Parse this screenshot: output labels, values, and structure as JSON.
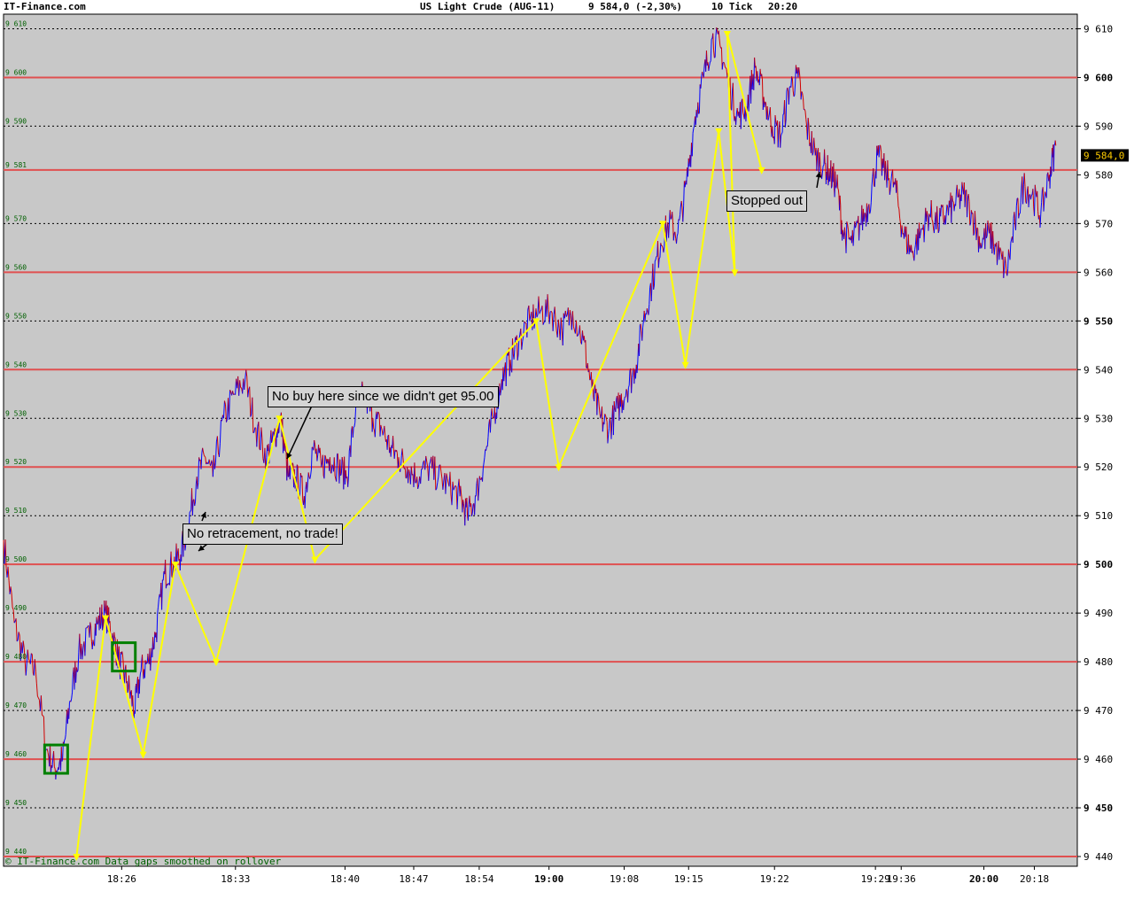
{
  "header": {
    "site": "IT-Finance.com",
    "instrument": "US Light Crude (AUG-11)",
    "quote": "9 584,0 (-2,30%)",
    "interval": "10 Tick",
    "time": "20:20"
  },
  "footer": "© IT-Finance.com Data gaps smoothed on rollover",
  "colors": {
    "plot_bg": "#c8c8c8",
    "red_level": "#e05050",
    "price_up": "#0000ff",
    "price_down": "#d00000",
    "swing_line": "#ffff00",
    "entry_box": "#008000",
    "last_price_badge": "#ffcc00"
  },
  "annotations": {
    "no_buy": "No buy here since we didn't get 95.00",
    "no_retracement": "No retracement, no trade!",
    "stopped_out": "Stopped out"
  },
  "chart_data": {
    "type": "line",
    "title": "US Light Crude (AUG-11)",
    "ylim": [
      9438,
      9613
    ],
    "y_ticks_right": [
      {
        "value": 9610,
        "label": "9 610",
        "bold": false
      },
      {
        "value": 9600,
        "label": "9 600",
        "bold": true
      },
      {
        "value": 9590,
        "label": "9 590",
        "bold": false
      },
      {
        "value": 9580,
        "label": "9 580",
        "bold": false
      },
      {
        "value": 9570,
        "label": "9 570",
        "bold": false
      },
      {
        "value": 9560,
        "label": "9 560",
        "bold": false
      },
      {
        "value": 9550,
        "label": "9 550",
        "bold": true
      },
      {
        "value": 9540,
        "label": "9 540",
        "bold": false
      },
      {
        "value": 9530,
        "label": "9 530",
        "bold": false
      },
      {
        "value": 9520,
        "label": "9 520",
        "bold": false
      },
      {
        "value": 9510,
        "label": "9 510",
        "bold": false
      },
      {
        "value": 9500,
        "label": "9 500",
        "bold": true
      },
      {
        "value": 9490,
        "label": "9 490",
        "bold": false
      },
      {
        "value": 9480,
        "label": "9 480",
        "bold": false
      },
      {
        "value": 9470,
        "label": "9 470",
        "bold": false
      },
      {
        "value": 9460,
        "label": "9 460",
        "bold": false
      },
      {
        "value": 9450,
        "label": "9 450",
        "bold": true
      },
      {
        "value": 9440,
        "label": "9 440",
        "bold": false
      }
    ],
    "y_ticks_left": [
      {
        "value": 9610,
        "label": "9 610"
      },
      {
        "value": 9600,
        "label": "9 600"
      },
      {
        "value": 9590,
        "label": "9 590"
      },
      {
        "value": 9581,
        "label": "9 581"
      },
      {
        "value": 9570,
        "label": "9 570"
      },
      {
        "value": 9560,
        "label": "9 560"
      },
      {
        "value": 9550,
        "label": "9 550"
      },
      {
        "value": 9540,
        "label": "9 540"
      },
      {
        "value": 9530,
        "label": "9 530"
      },
      {
        "value": 9520,
        "label": "9 520"
      },
      {
        "value": 9510,
        "label": "9 510"
      },
      {
        "value": 9500,
        "label": "9 500"
      },
      {
        "value": 9490,
        "label": "9 490"
      },
      {
        "value": 9480,
        "label": "9 480"
      },
      {
        "value": 9470,
        "label": "9 470"
      },
      {
        "value": 9460,
        "label": "9 460"
      },
      {
        "value": 9450,
        "label": "9 450"
      },
      {
        "value": 9440,
        "label": "9 440"
      }
    ],
    "red_levels": [
      9600,
      9581,
      9560,
      9540,
      9520,
      9500,
      9480,
      9460,
      9440
    ],
    "dotted_levels": [
      9610,
      9590,
      9570,
      9550,
      9530,
      9510,
      9490,
      9470,
      9450
    ],
    "x_ticks": [
      {
        "label": "18:26",
        "pos": 0.11,
        "bold": false
      },
      {
        "label": "18:33",
        "pos": 0.216,
        "bold": false
      },
      {
        "label": "18:40",
        "pos": 0.318,
        "bold": false
      },
      {
        "label": "18:47",
        "pos": 0.382,
        "bold": false
      },
      {
        "label": "18:54",
        "pos": 0.443,
        "bold": false
      },
      {
        "label": "19:00",
        "pos": 0.508,
        "bold": true
      },
      {
        "label": "19:08",
        "pos": 0.578,
        "bold": false
      },
      {
        "label": "19:15",
        "pos": 0.638,
        "bold": false
      },
      {
        "label": "19:22",
        "pos": 0.718,
        "bold": false
      },
      {
        "label": "19:29",
        "pos": 0.812,
        "bold": false
      },
      {
        "label": "19:36",
        "pos": 0.836,
        "bold": false
      },
      {
        "label": "20:00",
        "pos": 0.913,
        "bold": true
      },
      {
        "label": "20:18",
        "pos": 0.96,
        "bold": false
      }
    ],
    "last_price": {
      "value": 9584,
      "label": "9 584,0"
    },
    "price_series": [
      [
        0.0,
        9505
      ],
      [
        0.01,
        9488
      ],
      [
        0.02,
        9480
      ],
      [
        0.03,
        9478
      ],
      [
        0.04,
        9462
      ],
      [
        0.048,
        9458
      ],
      [
        0.055,
        9460
      ],
      [
        0.062,
        9472
      ],
      [
        0.07,
        9482
      ],
      [
        0.08,
        9485
      ],
      [
        0.088,
        9488
      ],
      [
        0.095,
        9490
      ],
      [
        0.102,
        9485
      ],
      [
        0.108,
        9480
      ],
      [
        0.115,
        9476
      ],
      [
        0.122,
        9470
      ],
      [
        0.128,
        9478
      ],
      [
        0.135,
        9480
      ],
      [
        0.142,
        9486
      ],
      [
        0.15,
        9498
      ],
      [
        0.158,
        9500
      ],
      [
        0.165,
        9502
      ],
      [
        0.172,
        9508
      ],
      [
        0.18,
        9518
      ],
      [
        0.188,
        9522
      ],
      [
        0.195,
        9518
      ],
      [
        0.205,
        9530
      ],
      [
        0.215,
        9535
      ],
      [
        0.225,
        9538
      ],
      [
        0.235,
        9528
      ],
      [
        0.245,
        9522
      ],
      [
        0.252,
        9526
      ],
      [
        0.258,
        9530
      ],
      [
        0.265,
        9518
      ],
      [
        0.272,
        9518
      ],
      [
        0.28,
        9514
      ],
      [
        0.288,
        9524
      ],
      [
        0.296,
        9520
      ],
      [
        0.304,
        9522
      ],
      [
        0.312,
        9520
      ],
      [
        0.32,
        9518
      ],
      [
        0.328,
        9532
      ],
      [
        0.336,
        9535
      ],
      [
        0.344,
        9530
      ],
      [
        0.352,
        9528
      ],
      [
        0.36,
        9524
      ],
      [
        0.368,
        9522
      ],
      [
        0.376,
        9520
      ],
      [
        0.385,
        9518
      ],
      [
        0.395,
        9520
      ],
      [
        0.405,
        9518
      ],
      [
        0.415,
        9516
      ],
      [
        0.425,
        9514
      ],
      [
        0.432,
        9510
      ],
      [
        0.44,
        9514
      ],
      [
        0.448,
        9522
      ],
      [
        0.456,
        9530
      ],
      [
        0.464,
        9538
      ],
      [
        0.472,
        9542
      ],
      [
        0.48,
        9546
      ],
      [
        0.49,
        9550
      ],
      [
        0.5,
        9552
      ],
      [
        0.51,
        9552
      ],
      [
        0.52,
        9548
      ],
      [
        0.53,
        9552
      ],
      [
        0.54,
        9546
      ],
      [
        0.548,
        9536
      ],
      [
        0.556,
        9530
      ],
      [
        0.564,
        9528
      ],
      [
        0.572,
        9532
      ],
      [
        0.58,
        9536
      ],
      [
        0.588,
        9540
      ],
      [
        0.596,
        9550
      ],
      [
        0.604,
        9558
      ],
      [
        0.612,
        9566
      ],
      [
        0.62,
        9570
      ],
      [
        0.628,
        9568
      ],
      [
        0.636,
        9578
      ],
      [
        0.644,
        9592
      ],
      [
        0.652,
        9600
      ],
      [
        0.66,
        9608
      ],
      [
        0.668,
        9606
      ],
      [
        0.676,
        9598
      ],
      [
        0.684,
        9592
      ],
      [
        0.692,
        9594
      ],
      [
        0.7,
        9602
      ],
      [
        0.708,
        9596
      ],
      [
        0.716,
        9590
      ],
      [
        0.724,
        9588
      ],
      [
        0.732,
        9598
      ],
      [
        0.74,
        9600
      ],
      [
        0.748,
        9590
      ],
      [
        0.756,
        9584
      ],
      [
        0.764,
        9582
      ],
      [
        0.77,
        9580
      ],
      [
        0.776,
        9578
      ],
      [
        0.782,
        9568
      ],
      [
        0.79,
        9566
      ],
      [
        0.798,
        9570
      ],
      [
        0.806,
        9574
      ],
      [
        0.814,
        9584
      ],
      [
        0.822,
        9580
      ],
      [
        0.83,
        9578
      ],
      [
        0.838,
        9568
      ],
      [
        0.846,
        9564
      ],
      [
        0.854,
        9568
      ],
      [
        0.862,
        9572
      ],
      [
        0.87,
        9570
      ],
      [
        0.878,
        9572
      ],
      [
        0.886,
        9574
      ],
      [
        0.894,
        9576
      ],
      [
        0.902,
        9572
      ],
      [
        0.91,
        9566
      ],
      [
        0.918,
        9568
      ],
      [
        0.926,
        9564
      ],
      [
        0.934,
        9560
      ],
      [
        0.942,
        9570
      ],
      [
        0.95,
        9578
      ],
      [
        0.958,
        9576
      ],
      [
        0.966,
        9572
      ],
      [
        0.974,
        9580
      ],
      [
        0.98,
        9586
      ]
    ],
    "swing_lines": [
      [
        [
          0.068,
          9440
        ],
        [
          0.095,
          9489
        ],
        [
          0.13,
          9461
        ],
        [
          0.16,
          9500
        ],
        [
          0.198,
          9480
        ],
        [
          0.257,
          9530
        ],
        [
          0.29,
          9501
        ],
        [
          0.496,
          9550
        ],
        [
          0.517,
          9520
        ],
        [
          0.614,
          9570
        ],
        [
          0.635,
          9541
        ],
        [
          0.666,
          9589
        ],
        [
          0.681,
          9560
        ],
        [
          0.674,
          9609
        ],
        [
          0.706,
          9581
        ]
      ],
      [
        [
          0.16,
          9500
        ],
        [
          0.257,
          9530
        ]
      ]
    ],
    "entry_boxes": [
      {
        "x": 0.049,
        "y": 9460
      },
      {
        "x": 0.112,
        "y": 9481
      }
    ],
    "price_range_left": 0.0,
    "price_range_right": 1.0
  }
}
